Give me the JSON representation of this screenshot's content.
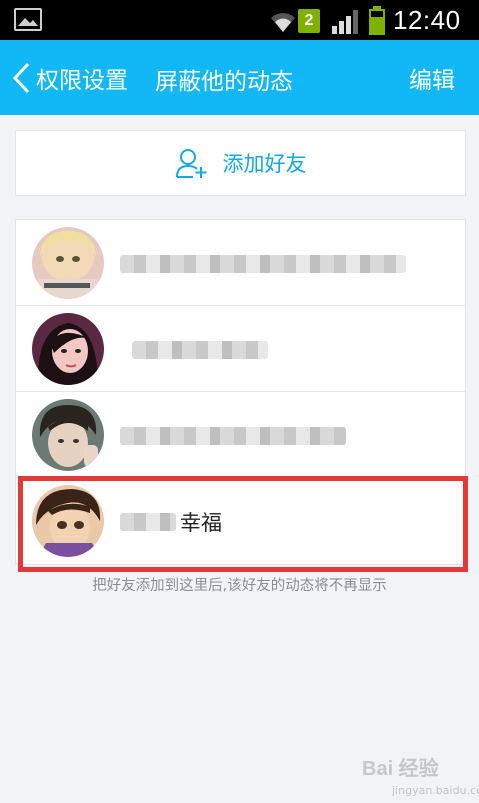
{
  "status_bar": {
    "notification_count": "2",
    "time": "12:40",
    "icons": [
      "gallery-icon",
      "wifi-icon",
      "signal-icon",
      "battery-icon"
    ]
  },
  "header": {
    "back_label": "权限设置",
    "title": "屏蔽他的动态",
    "edit_label": "编辑"
  },
  "add_friend": {
    "label": "添加好友",
    "icon": "add-user-icon"
  },
  "friends": [
    {
      "name_visible": "",
      "blurred": true
    },
    {
      "name_visible": "",
      "blurred": true
    },
    {
      "name_visible": "",
      "blurred": true
    },
    {
      "name_visible": "幸福",
      "blurred": true
    }
  ],
  "hint": "把好友添加到这里后,该好友的动态将不再显示",
  "watermark": {
    "text": "Bai 经验",
    "sub": "jingyan.baidu.com"
  },
  "colors": {
    "accent": "#12b7f5",
    "highlight": "#e23a3a",
    "background": "#f2f3f6"
  }
}
